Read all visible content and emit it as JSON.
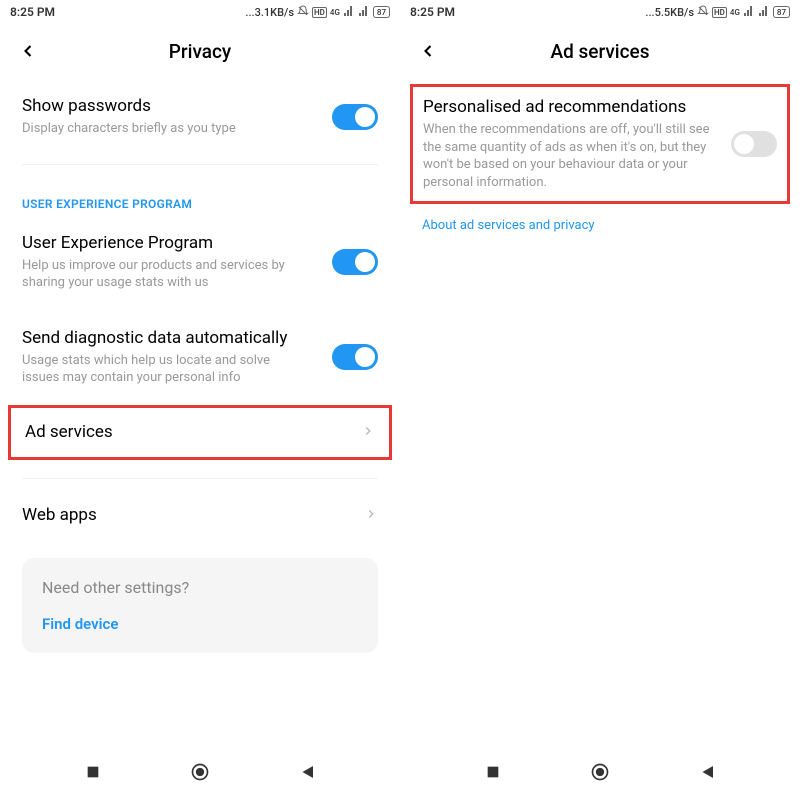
{
  "left": {
    "status": {
      "time": "8:25 PM",
      "rate": "...3.1KB/s",
      "battery": "87"
    },
    "header": {
      "title": "Privacy"
    },
    "showPasswords": {
      "title": "Show passwords",
      "desc": "Display characters briefly as you type"
    },
    "sectionHeader": "USER EXPERIENCE PROGRAM",
    "uep": {
      "title": "User Experience Program",
      "desc": "Help us improve our products and services by sharing your usage stats with us"
    },
    "diag": {
      "title": "Send diagnostic data automatically",
      "desc": "Usage stats which help us locate and solve issues may contain your personal info"
    },
    "adServices": {
      "title": "Ad services"
    },
    "webApps": {
      "title": "Web apps"
    },
    "card": {
      "title": "Need other settings?",
      "link": "Find device"
    }
  },
  "right": {
    "status": {
      "time": "8:25 PM",
      "rate": "...5.5KB/s",
      "battery": "87"
    },
    "header": {
      "title": "Ad services"
    },
    "personalised": {
      "title": "Personalised ad recommendations",
      "desc": "When the recommendations are off, you'll still see the same quantity of ads as when it's on, but they won't be based on your behaviour data or your personal information."
    },
    "aboutLink": "About ad services and privacy"
  },
  "icons": {
    "4g": "4G"
  }
}
